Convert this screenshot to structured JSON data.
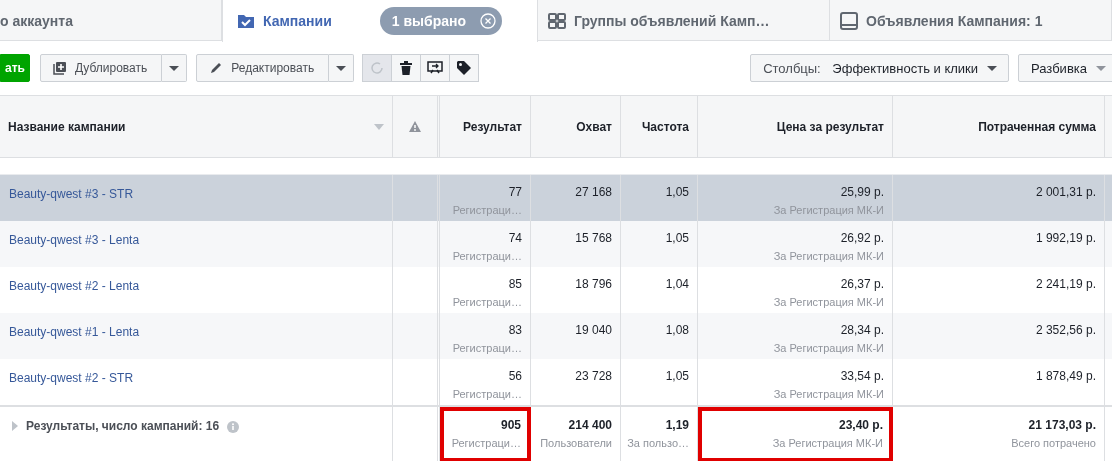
{
  "tabs": [
    {
      "label": "о аккаунта",
      "kind": "account",
      "selected": false
    },
    {
      "label": "Кампании",
      "kind": "campaigns",
      "selected": true,
      "badge": "1 выбрано"
    },
    {
      "label": "Группы объявлений Камп…",
      "kind": "adsets",
      "selected": false
    },
    {
      "label": "Объявления Кампания: 1",
      "kind": "ads",
      "selected": false
    }
  ],
  "toolbar": {
    "buttons": [
      {
        "label": "ать",
        "kind": "primary"
      },
      {
        "label": "Дублировать",
        "kind": "duplicate"
      },
      {
        "label": "Редактировать",
        "kind": "edit"
      }
    ],
    "icon_buttons": [
      {
        "kind": "refresh",
        "disabled": true
      },
      {
        "kind": "delete",
        "disabled": false
      },
      {
        "kind": "rules",
        "disabled": false
      },
      {
        "kind": "tag",
        "disabled": false
      }
    ],
    "columns_button": {
      "prefix": "Столбцы:",
      "value": "Эффективность и клики"
    },
    "breakdown_button": {
      "label": "Разбивка"
    }
  },
  "table": {
    "columns": [
      {
        "label": "Название кампании",
        "kind": "name"
      },
      {
        "kind": "warning"
      },
      {
        "label": "Результат",
        "kind": "metric"
      },
      {
        "label": "Охват",
        "kind": "metric"
      },
      {
        "label": "Частота",
        "kind": "metric"
      },
      {
        "label": "Цена за результат",
        "kind": "metric"
      },
      {
        "label": "Потраченная сумма",
        "kind": "metric"
      }
    ],
    "rows": [
      {
        "name": "Beauty-qwest #3 - STR",
        "selected": true,
        "results": "77",
        "results_sub": "Регистраци…",
        "reach": "27 168",
        "frequency": "1,05",
        "cost": "25,99 р.",
        "cost_sub": "За Регистрация МК-И",
        "spent": "2 001,31 р."
      },
      {
        "name": "Beauty-qwest #3 - Lenta",
        "selected": false,
        "results": "74",
        "results_sub": "Регистраци…",
        "reach": "15 768",
        "frequency": "1,05",
        "cost": "26,92 р.",
        "cost_sub": "За Регистрация МК-И",
        "spent": "1 992,19 р."
      },
      {
        "name": "Beauty-qwest #2 - Lenta",
        "selected": false,
        "results": "85",
        "results_sub": "Регистраци…",
        "reach": "18 796",
        "frequency": "1,04",
        "cost": "26,37 р.",
        "cost_sub": "За Регистрация МК-И",
        "spent": "2 241,19 р."
      },
      {
        "name": "Beauty-qwest #1 - Lenta",
        "selected": false,
        "results": "83",
        "results_sub": "Регистраци…",
        "reach": "19 040",
        "frequency": "1,08",
        "cost": "28,34 р.",
        "cost_sub": "За Регистрация МК-И",
        "spent": "2 352,56 р."
      },
      {
        "name": "Beauty-qwest #2 - STR",
        "selected": false,
        "results": "56",
        "results_sub": "Регистраци…",
        "reach": "23 728",
        "frequency": "1,05",
        "cost": "33,54 р.",
        "cost_sub": "За Регистрация МК-И",
        "spent": "1 878,49 р."
      }
    ],
    "summary": {
      "label": "Результаты, число кампаний: 16",
      "cells": [
        {
          "value": "905",
          "sub": "Регистраци…",
          "highlighted": true
        },
        {
          "value": "214 400",
          "sub": "Пользователи",
          "highlighted": false
        },
        {
          "value": "1,19",
          "sub": "За пользо…",
          "highlighted": false
        },
        {
          "value": "23,40 р.",
          "sub": "За Регистрация МК-И",
          "highlighted": true
        },
        {
          "value": "21 173,03 р.",
          "sub": "Всего потрачено",
          "highlighted": false
        }
      ]
    }
  }
}
